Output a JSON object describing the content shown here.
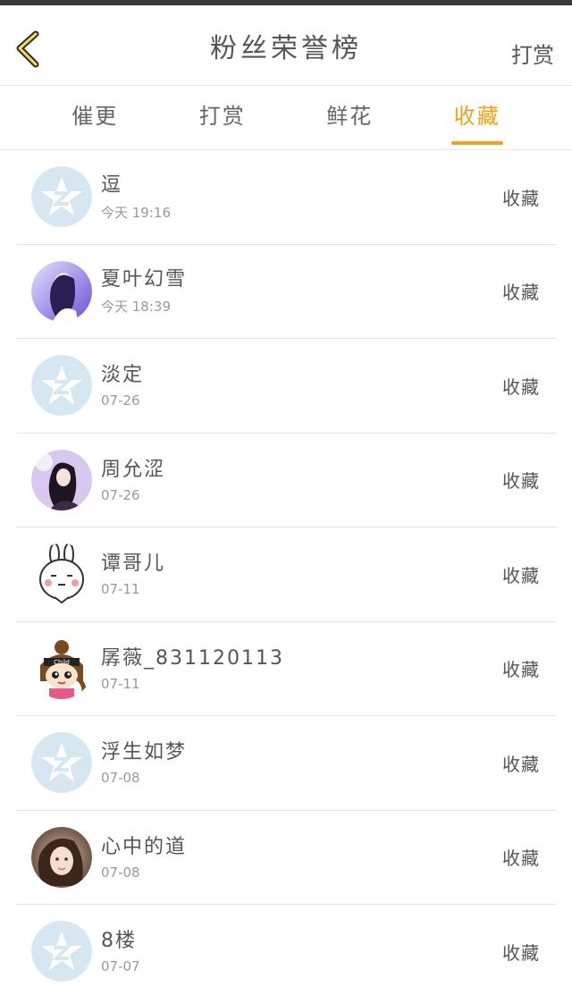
{
  "header": {
    "back_icon": "chevron-left-icon",
    "title": "粉丝荣誉榜",
    "action_label": "打赏",
    "accent_color": "#f0a020"
  },
  "tabs": [
    {
      "label": "催更",
      "active": false
    },
    {
      "label": "打赏",
      "active": false
    },
    {
      "label": "鲜花",
      "active": false
    },
    {
      "label": "收藏",
      "active": true
    }
  ],
  "rows": [
    {
      "name": "逗",
      "time": "今天 19:16",
      "tag": "收藏",
      "avatar": "default-star"
    },
    {
      "name": "夏叶幻雪",
      "time": "今天 18:39",
      "tag": "收藏",
      "avatar": "photo-purple"
    },
    {
      "name": "淡定",
      "time": "07-26",
      "tag": "收藏",
      "avatar": "default-star"
    },
    {
      "name": "周允涩",
      "time": "07-26",
      "tag": "收藏",
      "avatar": "photo-girl"
    },
    {
      "name": "谭哥儿",
      "time": "07-11",
      "tag": "收藏",
      "avatar": "rabbit"
    },
    {
      "name": "孱薇_831120113",
      "time": "07-11",
      "tag": "收藏",
      "avatar": "cartoon-girl"
    },
    {
      "name": "浮生如梦",
      "time": "07-08",
      "tag": "收藏",
      "avatar": "default-star"
    },
    {
      "name": "心中的道",
      "time": "07-08",
      "tag": "收藏",
      "avatar": "photo-selfie"
    },
    {
      "name": "8楼",
      "time": "07-07",
      "tag": "收藏",
      "avatar": "default-star"
    }
  ]
}
